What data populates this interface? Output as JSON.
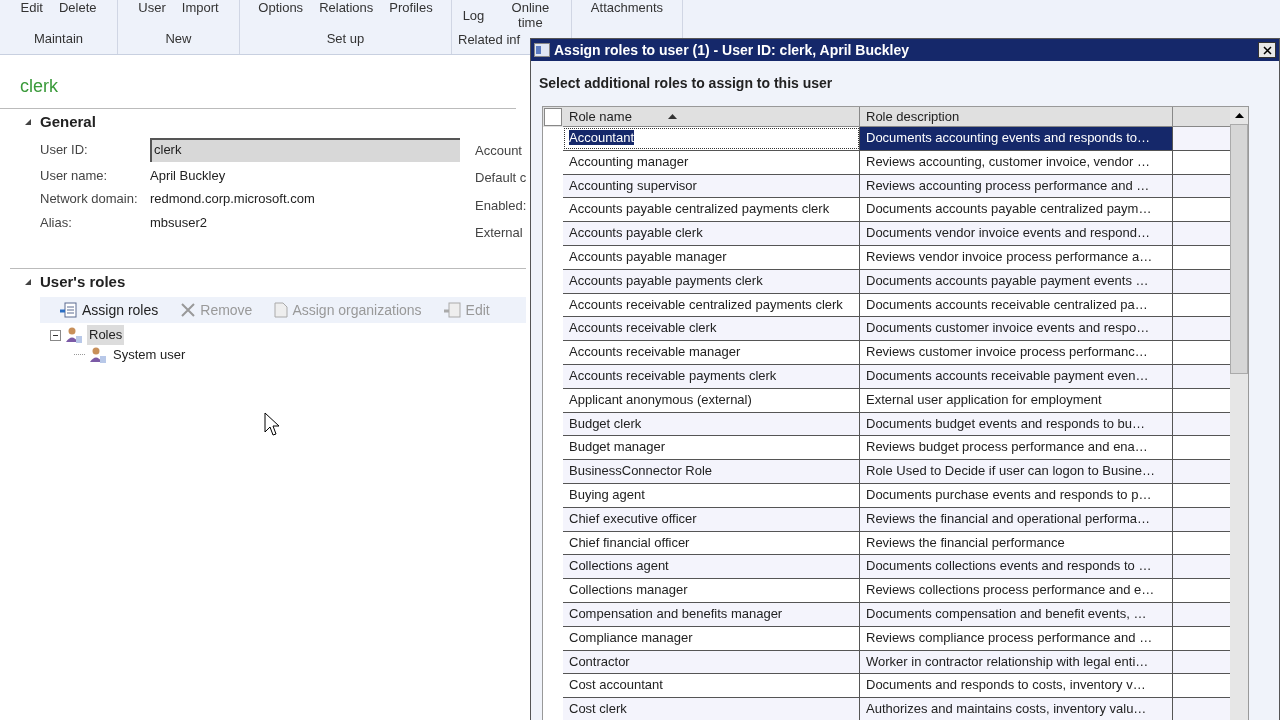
{
  "ribbon": {
    "groups": [
      {
        "label": "Maintain",
        "buttons": [
          "Edit",
          "Delete"
        ]
      },
      {
        "label": "New",
        "buttons": [
          "User",
          "Import"
        ]
      },
      {
        "label": "Set up",
        "buttons": [
          "Options",
          "Relations",
          "Profiles"
        ]
      },
      {
        "label": "Related inf",
        "buttons": [
          "Log",
          "Online time"
        ]
      },
      {
        "buttons": [
          "Attachments"
        ]
      }
    ]
  },
  "record_title": "clerk",
  "general": {
    "title": "General",
    "expanded": true,
    "fields": [
      {
        "label": "User ID:",
        "value": "clerk",
        "kind": "input"
      },
      {
        "label": "User name:",
        "value": "April Buckley",
        "kind": "text"
      },
      {
        "label": "Network domain:",
        "value": "redmond.corp.microsoft.com",
        "kind": "text"
      },
      {
        "label": "Alias:",
        "value": "mbsuser2",
        "kind": "text"
      }
    ],
    "right_labels": [
      "Account",
      "Default c",
      "Enabled:",
      "External"
    ]
  },
  "roles_section": {
    "title": "User's roles",
    "expanded": true,
    "toolbar": [
      {
        "label": "Assign roles",
        "disabled": false
      },
      {
        "label": "Remove",
        "disabled": true
      },
      {
        "label": "Assign organizations",
        "disabled": true
      },
      {
        "label": "Edit",
        "disabled": true
      }
    ],
    "tree": [
      {
        "label": "Roles",
        "selected": true,
        "expanded": true,
        "children": [
          {
            "label": "System user",
            "selected": false
          }
        ]
      }
    ]
  },
  "dialog": {
    "title": "Assign roles to user (1) - User ID: clerk, April Buckley",
    "instruction": "Select additional roles to assign to this user",
    "columns": [
      "Role name",
      "Role description"
    ],
    "select_all": {
      "checked": false
    },
    "rows": [
      {
        "name": "Accountant",
        "description": "Documents accounting events and responds to…",
        "selected": true
      },
      {
        "name": "Accounting manager",
        "description": "Reviews accounting, customer invoice, vendor …",
        "selected": false
      },
      {
        "name": "Accounting supervisor",
        "description": "Reviews accounting process performance and …",
        "selected": false
      },
      {
        "name": "Accounts payable centralized payments clerk",
        "description": "Documents accounts payable centralized paym…",
        "selected": false
      },
      {
        "name": "Accounts payable clerk",
        "description": "Documents vendor invoice events and respond…",
        "selected": false
      },
      {
        "name": "Accounts payable manager",
        "description": "Reviews vendor invoice process performance a…",
        "selected": false
      },
      {
        "name": "Accounts payable payments clerk",
        "description": "Documents accounts payable payment events …",
        "selected": false
      },
      {
        "name": "Accounts receivable centralized payments clerk",
        "description": "Documents accounts receivable centralized pa…",
        "selected": false
      },
      {
        "name": "Accounts receivable clerk",
        "description": "Documents customer invoice events and respo…",
        "selected": false
      },
      {
        "name": "Accounts receivable manager",
        "description": "Reviews customer invoice process performanc…",
        "selected": false
      },
      {
        "name": "Accounts receivable payments clerk",
        "description": "Documents accounts receivable payment even…",
        "selected": false
      },
      {
        "name": "Applicant anonymous (external)",
        "description": "External user application for employment",
        "selected": false
      },
      {
        "name": "Budget clerk",
        "description": "Documents budget events and responds to bu…",
        "selected": false
      },
      {
        "name": "Budget manager",
        "description": "Reviews budget process performance and ena…",
        "selected": false
      },
      {
        "name": "BusinessConnector Role",
        "description": "Role Used to Decide if user can logon to Busine…",
        "selected": false
      },
      {
        "name": "Buying agent",
        "description": "Documents purchase events and responds to p…",
        "selected": false
      },
      {
        "name": "Chief executive officer",
        "description": "Reviews the financial and operational performa…",
        "selected": false
      },
      {
        "name": "Chief financial officer",
        "description": "Reviews the financial performance",
        "selected": false
      },
      {
        "name": "Collections agent",
        "description": "Documents collections events and responds to …",
        "selected": false
      },
      {
        "name": "Collections manager",
        "description": "Reviews collections process performance and e…",
        "selected": false
      },
      {
        "name": "Compensation and benefits manager",
        "description": "Documents compensation and benefit events, …",
        "selected": false
      },
      {
        "name": "Compliance manager",
        "description": "Reviews compliance process performance and …",
        "selected": false
      },
      {
        "name": "Contractor",
        "description": "Worker in contractor relationship with legal enti…",
        "selected": false
      },
      {
        "name": "Cost accountant",
        "description": "Documents and responds to costs, inventory v…",
        "selected": false
      },
      {
        "name": "Cost clerk",
        "description": "Authorizes and maintains costs, inventory valu…",
        "selected": false
      }
    ]
  }
}
